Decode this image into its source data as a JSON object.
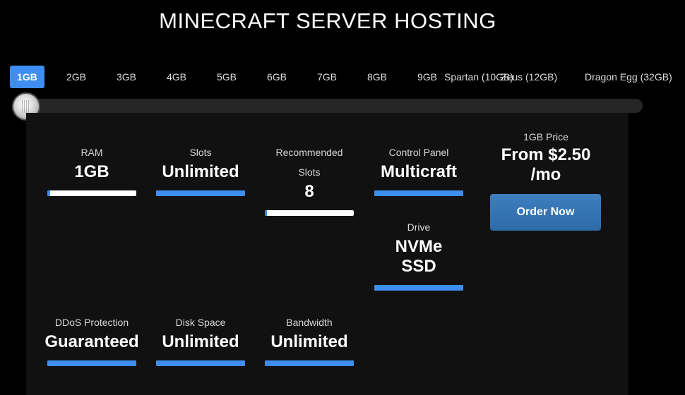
{
  "title": "MINECRAFT SERVER HOSTING",
  "plans": [
    "1GB",
    "2GB",
    "3GB",
    "4GB",
    "5GB",
    "6GB",
    "7GB",
    "8GB",
    "9GB",
    "Spartan (10GB)",
    "Zeus (12GB)",
    "Dragon Egg (32GB)"
  ],
  "selected_plan": "1GB",
  "specs": {
    "ram": {
      "label": "RAM",
      "value": "1GB",
      "level": 0.03
    },
    "slots": {
      "label": "Slots",
      "value": "Unlimited",
      "level": 1.0
    },
    "recommended": {
      "label1": "Recommended",
      "label2": "Slots",
      "value": "8",
      "level": 0.02
    },
    "control": {
      "label": "Control Panel",
      "value": "Multicraft",
      "level": 1.0
    },
    "drive": {
      "label": "Drive",
      "value1": "NVMe",
      "value2": "SSD",
      "level": 1.0
    },
    "ddos": {
      "label": "DDoS Protection",
      "value": "Guaranteed",
      "level": 1.0
    },
    "disk": {
      "label": "Disk Space",
      "value": "Unlimited",
      "level": 1.0
    },
    "bandwidth": {
      "label": "Bandwidth",
      "value": "Unlimited",
      "level": 1.0
    }
  },
  "price": {
    "label": "1GB Price",
    "line1": "From $2.50",
    "line2": "/mo"
  },
  "order_label": "Order Now",
  "colors": {
    "accent": "#3d8ef0",
    "button": "#2f6fae",
    "panel": "#111111"
  }
}
